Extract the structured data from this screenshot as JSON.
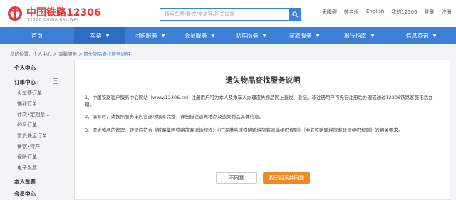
{
  "header": {
    "logo_cn": "中国铁路12306",
    "logo_en": "12306 CHINA RAILWAY",
    "search_placeholder": "搜索车票/餐饮/常旅客/相关规章",
    "top_links": [
      "无障碍",
      "敬老版",
      "English",
      "我的12306",
      "登录",
      "注册"
    ]
  },
  "nav": {
    "items": [
      {
        "label": "首页",
        "has_menu": false,
        "active": false
      },
      {
        "label": "车票",
        "has_menu": true,
        "active": true
      },
      {
        "label": "团购服务",
        "has_menu": true,
        "active": false
      },
      {
        "label": "会员服务",
        "has_menu": true,
        "active": false
      },
      {
        "label": "站车服务",
        "has_menu": true,
        "active": false
      },
      {
        "label": "商旅服务",
        "has_menu": true,
        "active": false
      },
      {
        "label": "出行指南",
        "has_menu": true,
        "active": false
      },
      {
        "label": "信息查询",
        "has_menu": true,
        "active": false
      }
    ],
    "chevron": "▼"
  },
  "breadcrumb": {
    "prefix": "您的位置：",
    "items": [
      "个人中心",
      "温馨服务"
    ],
    "current": "遗失物品查找服务说明",
    "separator": ">"
  },
  "sidebar": {
    "personal_center": "个人中心",
    "order_center": "订单中心",
    "order_items": [
      "火车票订单",
      "候补订单",
      "计次•定期票…",
      "约号订单",
      "雪具快运订单",
      "餐饮•特产",
      "保险订单",
      "电子发票"
    ],
    "my_tickets": "本人车票",
    "member_center": "会员中心",
    "toggle_symbol": "−"
  },
  "main": {
    "title": "遗失物品查找服务说明",
    "paragraphs": [
      "1、中国铁路客户服务中心网站（www.12306.cn）注册用户可为本人及乘车人办理遗失物品网上查找、登记。非注册用户可先行注册后办理或通过12306铁路客服电话办理。",
      "2、填写时，请按照服务单内容逐项填写完整，详细描述遗失地点及遗失物品具体信息。",
      "3、遗失物品的管理、转运应符合《铁路集团铁路旅客运输规程》《广深港高速铁路跨境旅客运输组织规则》《中老铁路跨境旅客联运组织规则》的相关要求。"
    ],
    "disagree_label": "不同意",
    "agree_label": "我已阅读并同意"
  },
  "colors": {
    "primary_blue": "#3b7fd6",
    "nav_active": "#2c6cc2",
    "logo_red": "#e03b3b",
    "agree_orange": "#f08a23"
  }
}
